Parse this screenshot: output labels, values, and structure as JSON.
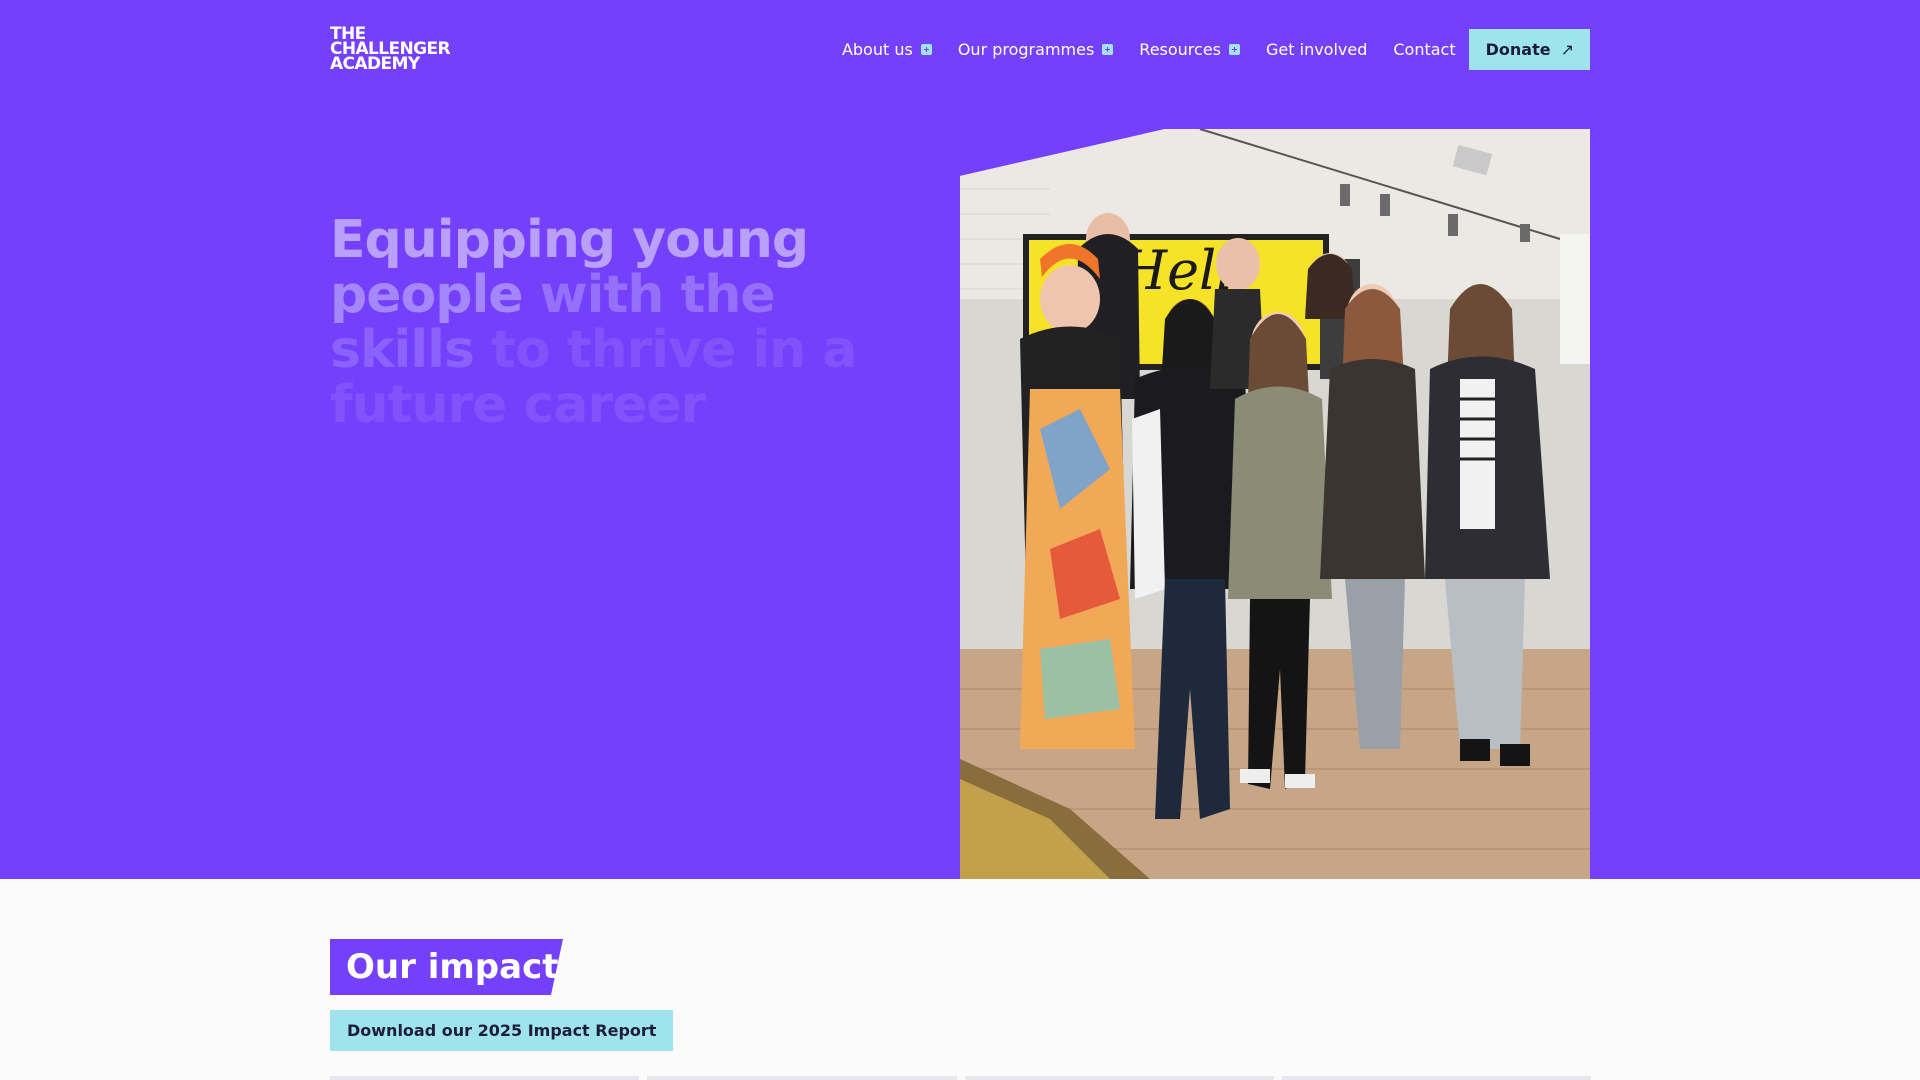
{
  "logo": {
    "line1": "THE",
    "line2": "CHALLENGER",
    "line3": "ACADEMY"
  },
  "nav": {
    "items": [
      {
        "label": "About us",
        "has_submenu": true
      },
      {
        "label": "Our programmes",
        "has_submenu": true
      },
      {
        "label": "Resources",
        "has_submenu": true
      },
      {
        "label": "Get involved",
        "has_submenu": false
      },
      {
        "label": "Contact",
        "has_submenu": false
      }
    ],
    "donate_label": "Donate",
    "donate_icon": "arrow-up-right-icon"
  },
  "hero": {
    "headline_words": [
      "Equipping young",
      "people",
      "with the",
      "skills",
      "to thrive in a future",
      "career"
    ],
    "photo_alt": "Group of young people standing in an office"
  },
  "impact": {
    "title": "Our impact",
    "report_button": "Download our 2025 Impact Report"
  },
  "colors": {
    "brand_purple": "#7540fb",
    "accent_cyan": "#9fe3ec",
    "text_dark": "#1d1d3a"
  }
}
